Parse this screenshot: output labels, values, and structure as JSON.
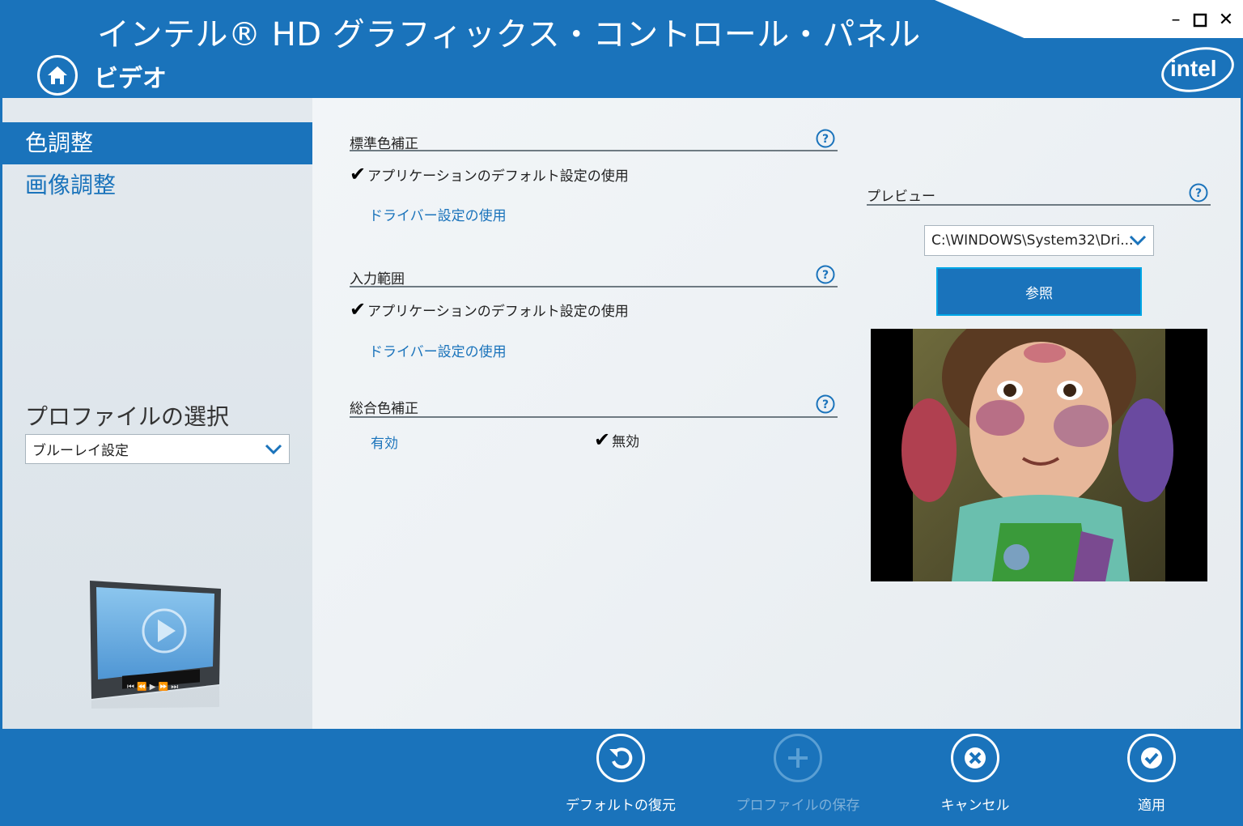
{
  "window": {
    "title": "インテル® HD グラフィックス・コントロール・パネル",
    "minimize_glyph": "–",
    "maximize_glyph": "□",
    "close_glyph": "✕"
  },
  "header": {
    "section": "ビデオ",
    "home_icon": "home-icon",
    "logo_text": "intel"
  },
  "sidebar": {
    "items": [
      {
        "label": "色調整",
        "active": true
      },
      {
        "label": "画像調整",
        "active": false
      }
    ],
    "profile_label": "プロファイルの選択",
    "profile_value": "ブルーレイ設定"
  },
  "groups": {
    "standard_color": {
      "title": "標準色補正",
      "selected": "アプリケーションのデフォルト設定の使用",
      "other": "ドライバー設定の使用"
    },
    "input_range": {
      "title": "入力範囲",
      "selected": "アプリケーションのデフォルト設定の使用",
      "other": "ドライバー設定の使用"
    },
    "total_color": {
      "title": "総合色補正",
      "enable": "有効",
      "disable": "無効"
    }
  },
  "preview": {
    "title": "プレビュー",
    "file_value": "C:\\WINDOWS\\System32\\Dri...",
    "browse_label": "参照"
  },
  "footer": {
    "restore_label": "デフォルトの復元",
    "save_profile_label": "プロファイルの保存",
    "cancel_label": "キャンセル",
    "apply_label": "適用"
  },
  "colors": {
    "accent": "#1a73bb",
    "focus_border": "#00a6e6"
  }
}
